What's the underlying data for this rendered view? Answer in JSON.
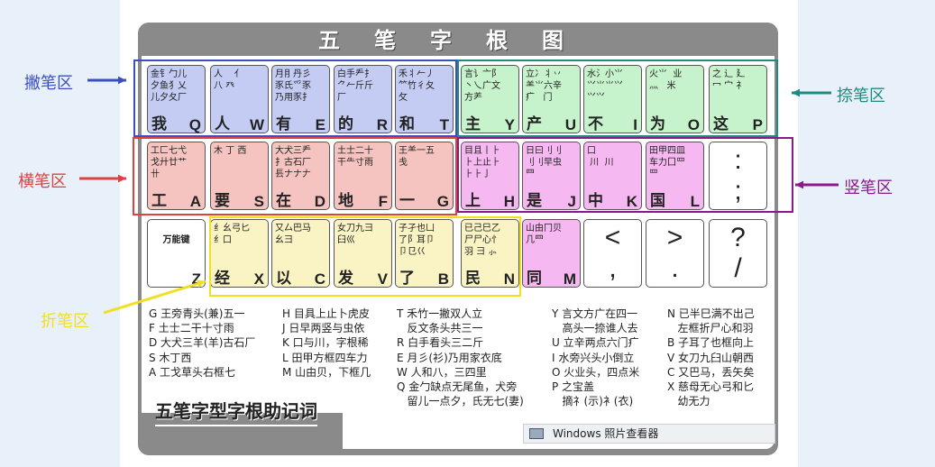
{
  "title": "五笔字根图",
  "zones": [
    {
      "label": "撇笔区",
      "color": "#3a50c0"
    },
    {
      "label": "捺笔区",
      "color": "#1e8a80"
    },
    {
      "label": "横笔区",
      "color": "#e04040"
    },
    {
      "label": "竖笔区",
      "color": "#8a1a8a"
    },
    {
      "label": "折笔区",
      "color": "#f0e020"
    }
  ],
  "keys": [
    {
      "l": "Q",
      "m": "我",
      "r": "金钅勹儿\n夕鱼犭乂\n儿夕夂厂",
      "z": 0
    },
    {
      "l": "W",
      "m": "人",
      "r": "人    亻\n八 癶",
      "z": 0
    },
    {
      "l": "E",
      "m": "有",
      "r": "月⺝丹彡\n豕氏⺤豕\n乃用豕⺘",
      "z": 0
    },
    {
      "l": "R",
      "m": "的",
      "r": "白手龵扌\n⺈𠂉斤斤\n厂",
      "z": 0
    },
    {
      "l": "T",
      "m": "和",
      "r": "禾⺦𠂉丿\n⺮竹彳夂\n攵",
      "z": 0
    },
    {
      "l": "Y",
      "m": "主",
      "r": "言讠亠⻖\n丶乀广文\n方⺶",
      "z": 1
    },
    {
      "l": "U",
      "m": "产",
      "r": "立冫丬丷\n⺷⺌六辛\n疒   门",
      "z": 1
    },
    {
      "l": "I",
      "m": "不",
      "r": "水氵小⺌\n⺍⺌⺌⺍\n⺍⺍",
      "z": 1
    },
    {
      "l": "O",
      "m": "为",
      "r": "火⺌  业\n灬   米",
      "z": 1
    },
    {
      "l": "P",
      "m": "这",
      "r": "之 辶 廴\n冖 宀 礻",
      "z": 1
    },
    {
      "l": "A",
      "m": "工",
      "r": "工匚七弋\n戈廾廿艹\n卄",
      "z": 2
    },
    {
      "l": "S",
      "m": "要",
      "r": "木 丁 西",
      "z": 2
    },
    {
      "l": "D",
      "m": "在",
      "r": "大犬三龵\n⺘古石厂\n镸ナナ𠂇",
      "z": 2
    },
    {
      "l": "F",
      "m": "地",
      "r": "土士二十\n干⺧寸雨",
      "z": 2
    },
    {
      "l": "G",
      "m": "一",
      "r": "王⺷一五\n戋",
      "z": 2
    },
    {
      "l": "H",
      "m": "上",
      "r": "目且丨⺊\n⺊上止⺊\n⺊⺊亅",
      "z": 3
    },
    {
      "l": "J",
      "m": "是",
      "r": "日曰刂刂\n刂刂早虫\n⺫",
      "z": 3
    },
    {
      "l": "K",
      "m": "中",
      "r": "口\n 川  川",
      "z": 3
    },
    {
      "l": "L",
      "m": "国",
      "r": "田甲四皿\n车力囗罒\n罒",
      "z": 3
    },
    {
      "l": "",
      "m": "",
      "p": ":\n;",
      "z": -1
    },
    {
      "l": "Z",
      "m": "",
      "r": "\n万能键",
      "z": -1
    },
    {
      "l": "X",
      "m": "经",
      "r": "纟幺弓匕\n纟口",
      "z": 4
    },
    {
      "l": "C",
      "m": "以",
      "r": "又厶巴马\n⺓⺕",
      "z": 4
    },
    {
      "l": "V",
      "m": "发",
      "r": "女刀九彐\n臼巛",
      "z": 4
    },
    {
      "l": "B",
      "m": "了",
      "r": "子孑也凵\n了阝耳卩\n卩㔾巜",
      "z": 4
    },
    {
      "l": "N",
      "m": "民",
      "r": "已己巳乙\n尸尸心忄\n羽 ⺕ ⺗",
      "z": 4
    },
    {
      "l": "M",
      "m": "同",
      "r": "山由冂贝\n几⺲",
      "z": 3
    },
    {
      "l": "",
      "m": "",
      "p": "<\n,",
      "z": -1
    },
    {
      "l": "",
      "m": "",
      "p": ">\n.",
      "z": -1
    },
    {
      "l": "",
      "m": "",
      "p": "?\n/",
      "z": -1
    }
  ],
  "mnemonics": [
    "G 王旁青头(兼)五一\nF 土士二干十寸雨\nD 大犬三羊(羊)古石厂\nS 木丁西\nA 工戈草头右框七",
    "H 目具上止卜虎皮\nJ 日早两竖与虫依\nK 口与川，字根稀\nL 田甲方框四车力\nM 山由贝，下框几",
    "T 禾竹一撇双人立\n   反文条头共三一\nR 白手看头三二斤\nE 月彡(衫)乃用家衣底\nW 人和八，三四里\nQ 金勹缺点无尾鱼，犬旁\n   留儿一点夕，氏无七(妻)",
    "Y 言文方广在四一\n   高头一捺谁人去\nU 立辛两点六门疒\nI 水旁兴头小倒立\nO 火业头，四点米\nP 之宝盖\n   摘礻(示)衤(衣)",
    "N 已半巳满不出己\n   左框折尸心和羽\nB 子耳了也框向上\nV 女刀九臼山朝西\nC 又巴马，丢矢矣\nX 慈母无心弓和匕\n   幼无力"
  ],
  "slogan": "五笔字型字根助记词",
  "viewer_label": "Windows 照片查看器"
}
